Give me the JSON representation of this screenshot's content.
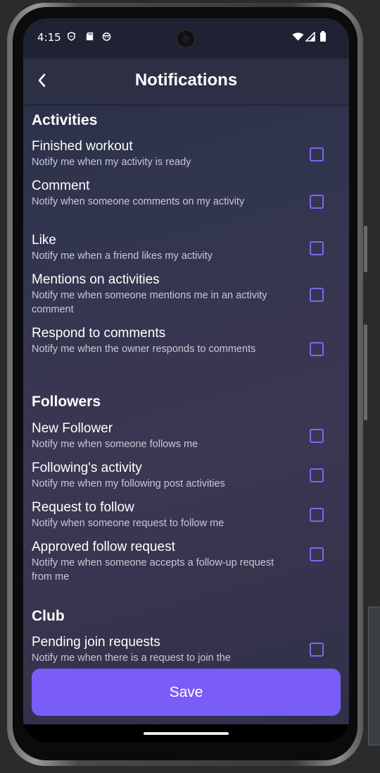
{
  "status_bar": {
    "time": "4:15"
  },
  "appbar": {
    "title": "Notifications"
  },
  "sections": [
    {
      "title": "Activities",
      "items": [
        {
          "title": "Finished workout",
          "desc": "Notify me when my activity is ready",
          "checked": false
        },
        {
          "title": "Comment",
          "desc": "Notify when someone comments on my activity",
          "checked": false
        },
        {
          "title": "Like",
          "desc": "Notify me when a friend likes my activity",
          "checked": false
        },
        {
          "title": "Mentions on activities",
          "desc": "Notify me when someone mentions me in an activity comment",
          "checked": false
        },
        {
          "title": "Respond to comments",
          "desc": "Notify me when the owner responds to comments",
          "checked": false
        }
      ]
    },
    {
      "title": "Followers",
      "items": [
        {
          "title": "New Follower",
          "desc": "Notify me when someone follows me",
          "checked": false
        },
        {
          "title": "Following's activity",
          "desc": "Notify me when my following post activities",
          "checked": false
        },
        {
          "title": "Request to follow",
          "desc": "Notify when someone request to follow me",
          "checked": false
        },
        {
          "title": "Approved follow request",
          "desc": "Notify me when someone accepts a follow-up request from me",
          "checked": false
        }
      ]
    },
    {
      "title": "Club",
      "items": [
        {
          "title": "Pending join requests",
          "desc": "Notify me when there is a request to join the",
          "checked": false
        }
      ]
    }
  ],
  "save_button": {
    "label": "Save"
  },
  "colors": {
    "accent": "#7a5cf8",
    "checkbox_border": "#7b68ee",
    "appbar": "#2d3045",
    "text_secondary": "#c8c8d4"
  }
}
